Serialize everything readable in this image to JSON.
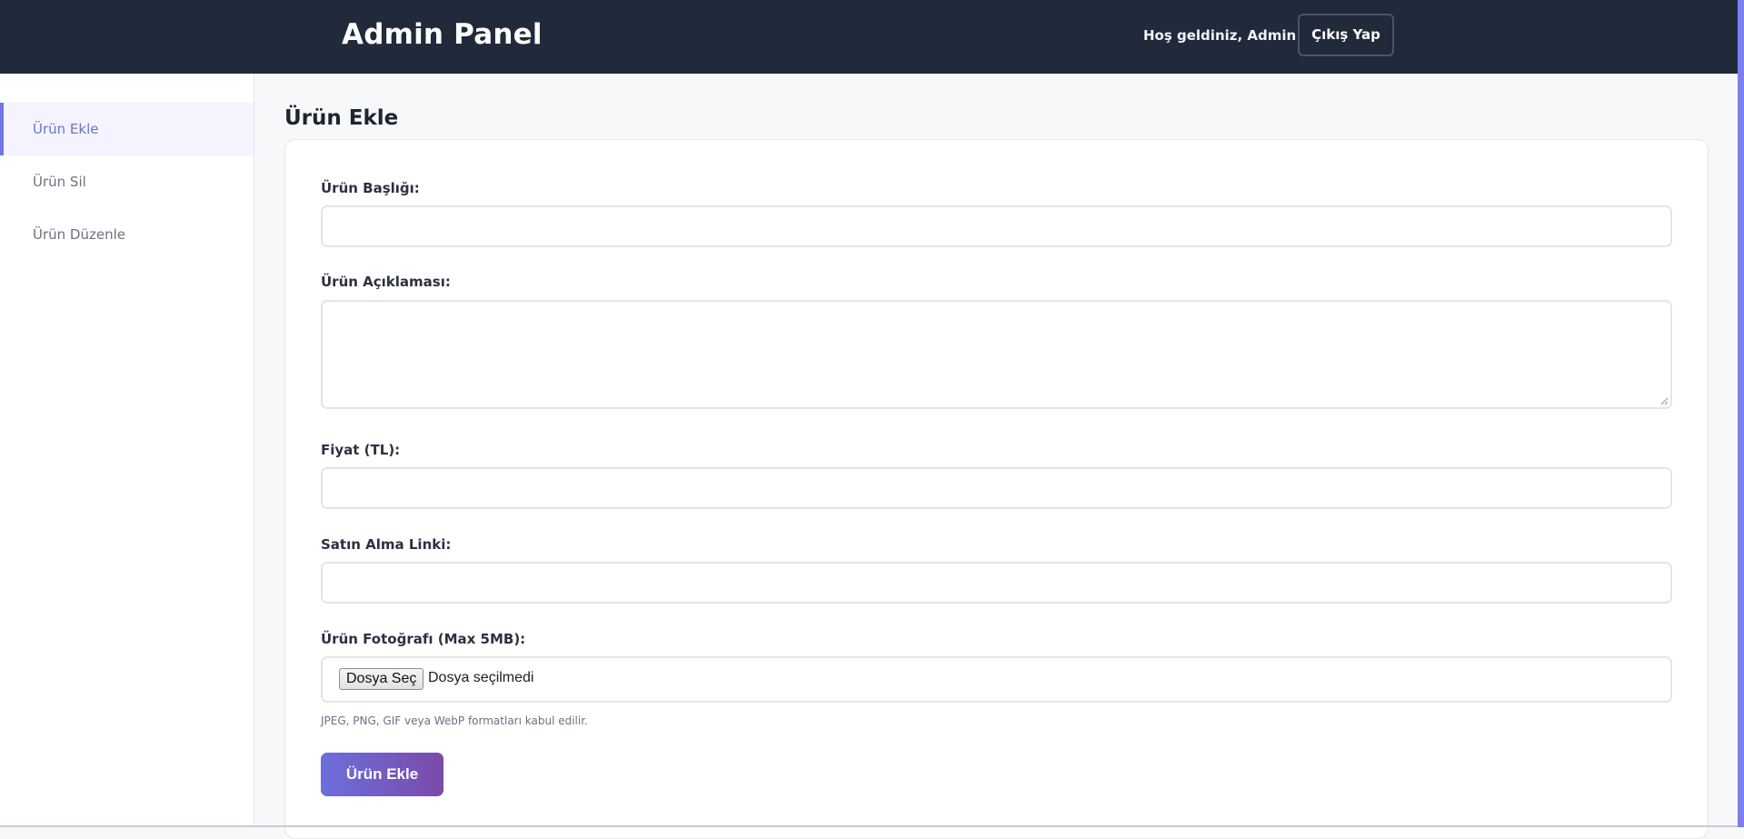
{
  "header": {
    "brand": "Admin Panel",
    "welcome": "Hoş geldiniz, Admin",
    "logout_label": "Çıkış Yap"
  },
  "sidebar": {
    "items": [
      {
        "label": "Ürün Ekle",
        "active": true
      },
      {
        "label": "Ürün Sil",
        "active": false
      },
      {
        "label": "Ürün Düzenle",
        "active": false
      }
    ]
  },
  "main": {
    "title": "Ürün Ekle",
    "form": {
      "title_label": "Ürün Başlığı:",
      "title_value": "",
      "description_label": "Ürün Açıklaması:",
      "description_value": "",
      "price_label": "Fiyat (TL):",
      "price_value": "",
      "link_label": "Satın Alma Linki:",
      "link_value": "",
      "photo_label": "Ürün Fotoğrafı (Max 5MB):",
      "choose_file_label": "Dosya Seç",
      "no_file_text": "Dosya seçilmedi",
      "hint": "JPEG, PNG, GIF veya WebP formatları kabul edilir.",
      "submit_label": "Ürün Ekle"
    }
  },
  "colors": {
    "header_bg": "#212a3a",
    "accent": "#6f76e8",
    "button_gradient_start": "#6c6fdc",
    "button_gradient_end": "#7a4aa9"
  }
}
